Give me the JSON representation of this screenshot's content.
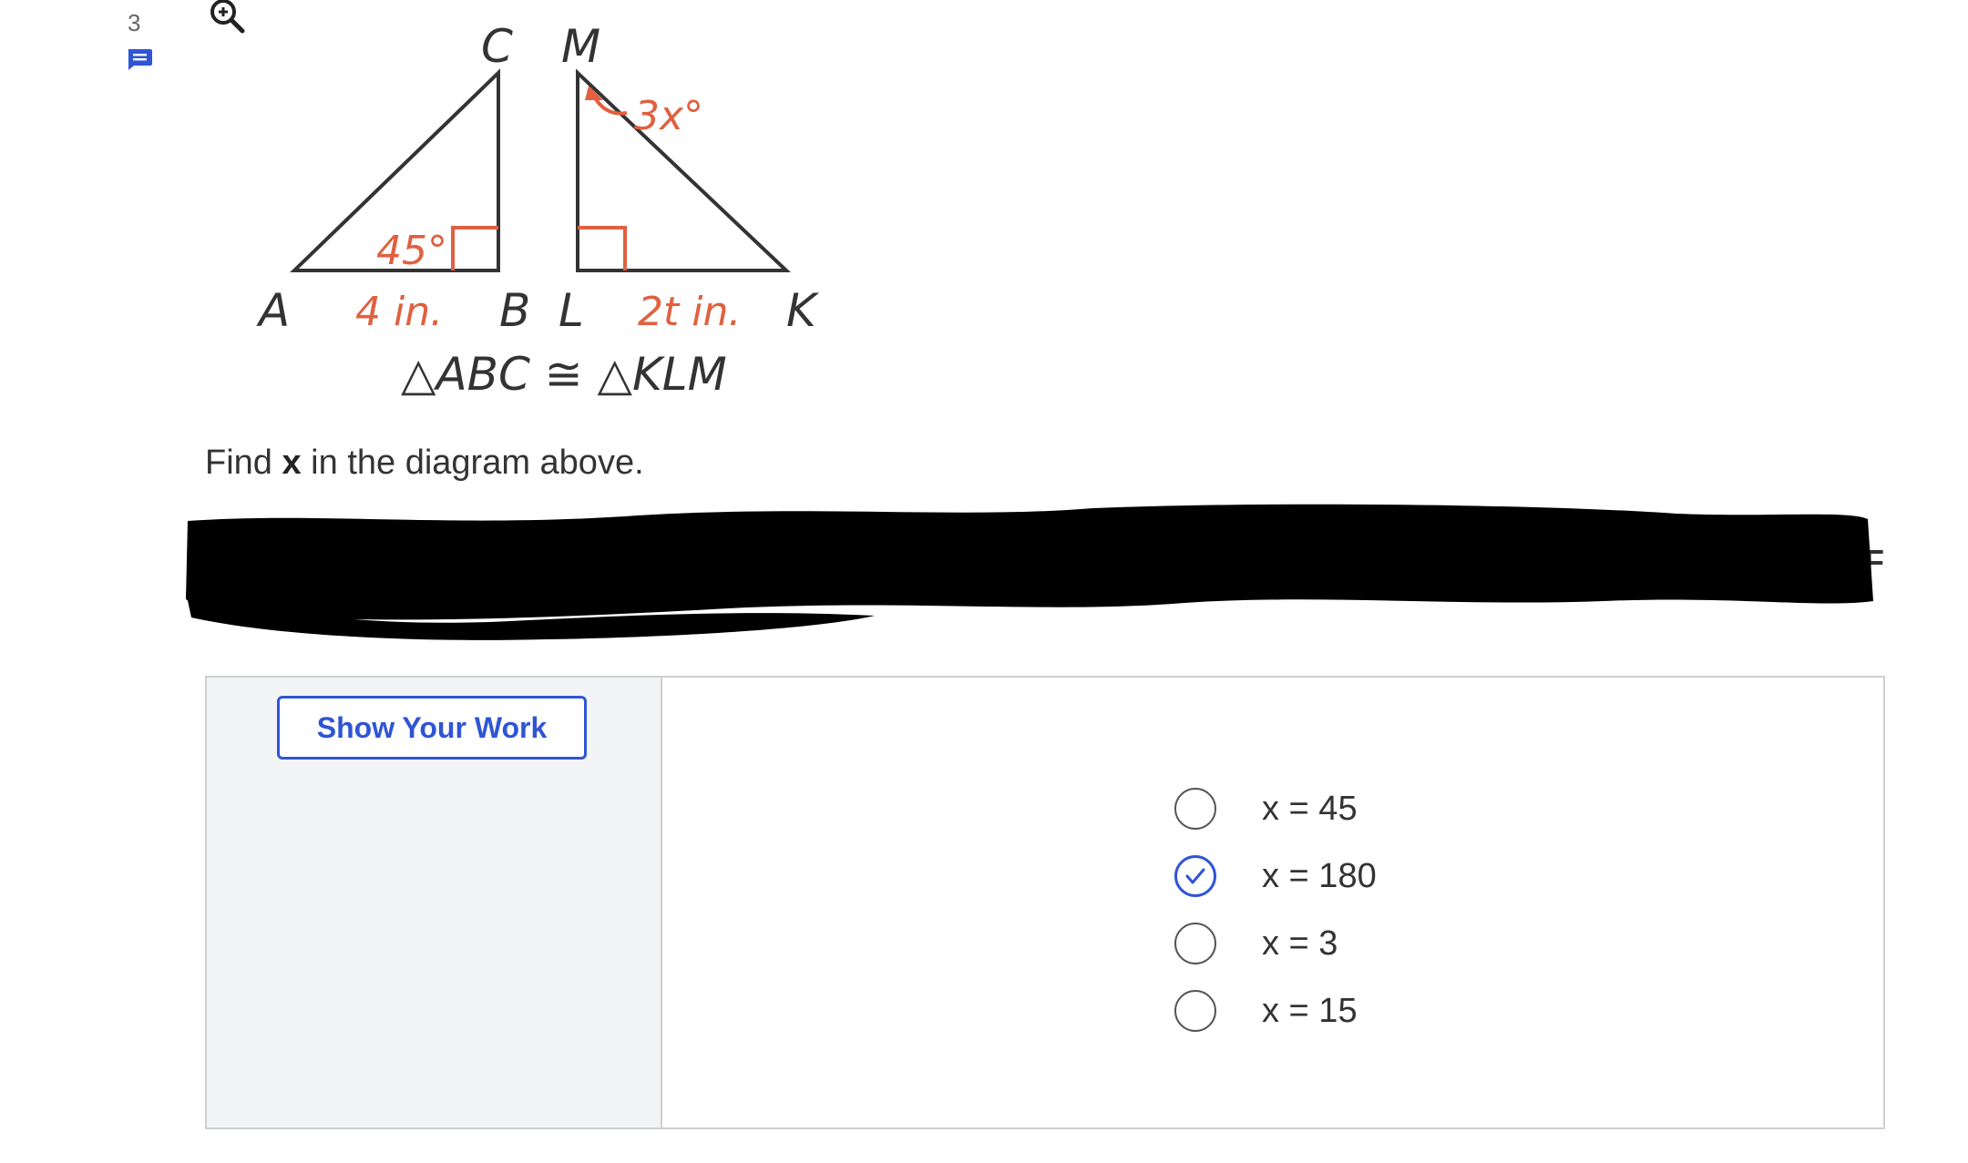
{
  "question": {
    "number": "3",
    "prompt_before": "Find ",
    "prompt_variable": "x",
    "prompt_after": " in the diagram above."
  },
  "diagram": {
    "labels": {
      "C": "C",
      "M": "M",
      "A": "A",
      "B": "B",
      "L": "L",
      "K": "K",
      "angle_M": "3x°",
      "angle_A": "45°",
      "side_AB": "4 in.",
      "side_LK": "2t in."
    },
    "congruence": "△ABC ≅ △KLM",
    "colors": {
      "lines": "#333333",
      "marks": "#e06040"
    }
  },
  "redacted_peek": {
    "line1_end": "IF"
  },
  "work_panel": {
    "button_label": "Show Your Work"
  },
  "choices": [
    {
      "label": "x = 45",
      "selected": false
    },
    {
      "label": "x = 180",
      "selected": true
    },
    {
      "label": "x = 3",
      "selected": false
    },
    {
      "label": "x = 15",
      "selected": false
    }
  ],
  "colors": {
    "accent": "#2f55d4",
    "panel_bg": "#f3f4f6",
    "border": "#cfcfcf"
  }
}
